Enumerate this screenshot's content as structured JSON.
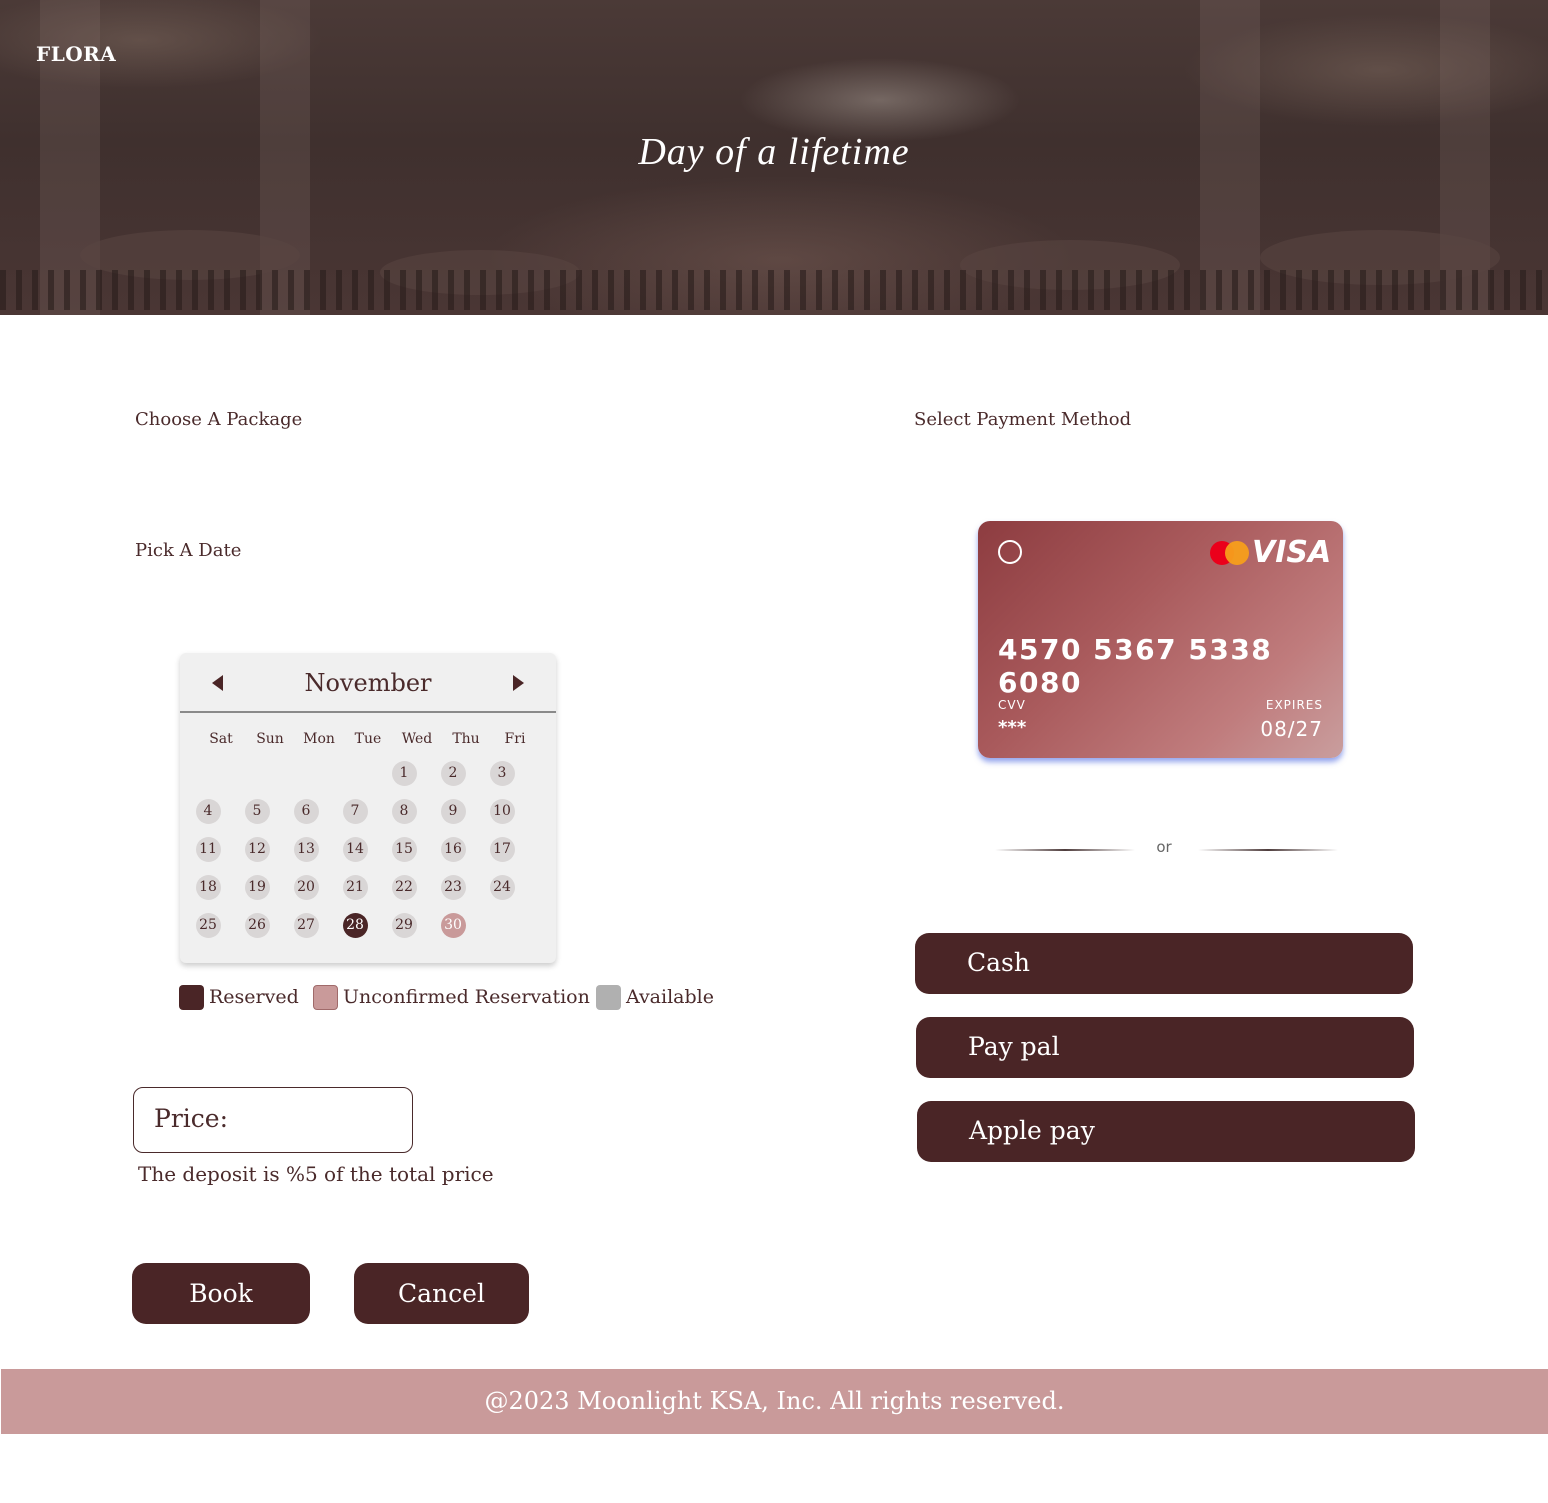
{
  "header": {
    "brand": "FLORA",
    "tagline": "Day of a lifetime"
  },
  "booking": {
    "package_label": "Choose A Package",
    "date_label": "Pick A Date",
    "calendar": {
      "month": "November",
      "weekdays": [
        "Sat",
        "Sun",
        "Mon",
        "Tue",
        "Wed",
        "Thu",
        "Fri"
      ],
      "days": [
        "1",
        "2",
        "3",
        "4",
        "5",
        "6",
        "7",
        "8",
        "9",
        "10",
        "11",
        "12",
        "13",
        "14",
        "15",
        "16",
        "17",
        "18",
        "19",
        "20",
        "21",
        "22",
        "23",
        "24",
        "25",
        "26",
        "27",
        "28",
        "29",
        "30"
      ],
      "reserved": [
        28
      ],
      "unconfirmed": [
        30
      ]
    },
    "legend": {
      "reserved": "Reserved",
      "unconfirmed": "Unconfirmed Reservation",
      "available": "Available"
    },
    "price_label": "Price:",
    "deposit_note": "The deposit is %5 of the total price",
    "book_label": "Book",
    "cancel_label": "Cancel"
  },
  "payment": {
    "label": "Select Payment Method",
    "card": {
      "brand": "VISA",
      "number": "4570 5367 5338 6080",
      "cvv_label": "CVV",
      "cvv": "***",
      "expires_label": "EXPIRES",
      "expires": "08/27"
    },
    "separator": "or",
    "methods": [
      "Cash",
      "Pay pal",
      "Apple pay"
    ]
  },
  "footer": {
    "text": "@2023 Moonlight KSA, Inc. All rights reserved."
  },
  "colors": {
    "primary": "#4a2526",
    "unconfirmed": "#c99a9a",
    "available": "#b0b0b0",
    "footer_bg": "#c99a9a"
  }
}
